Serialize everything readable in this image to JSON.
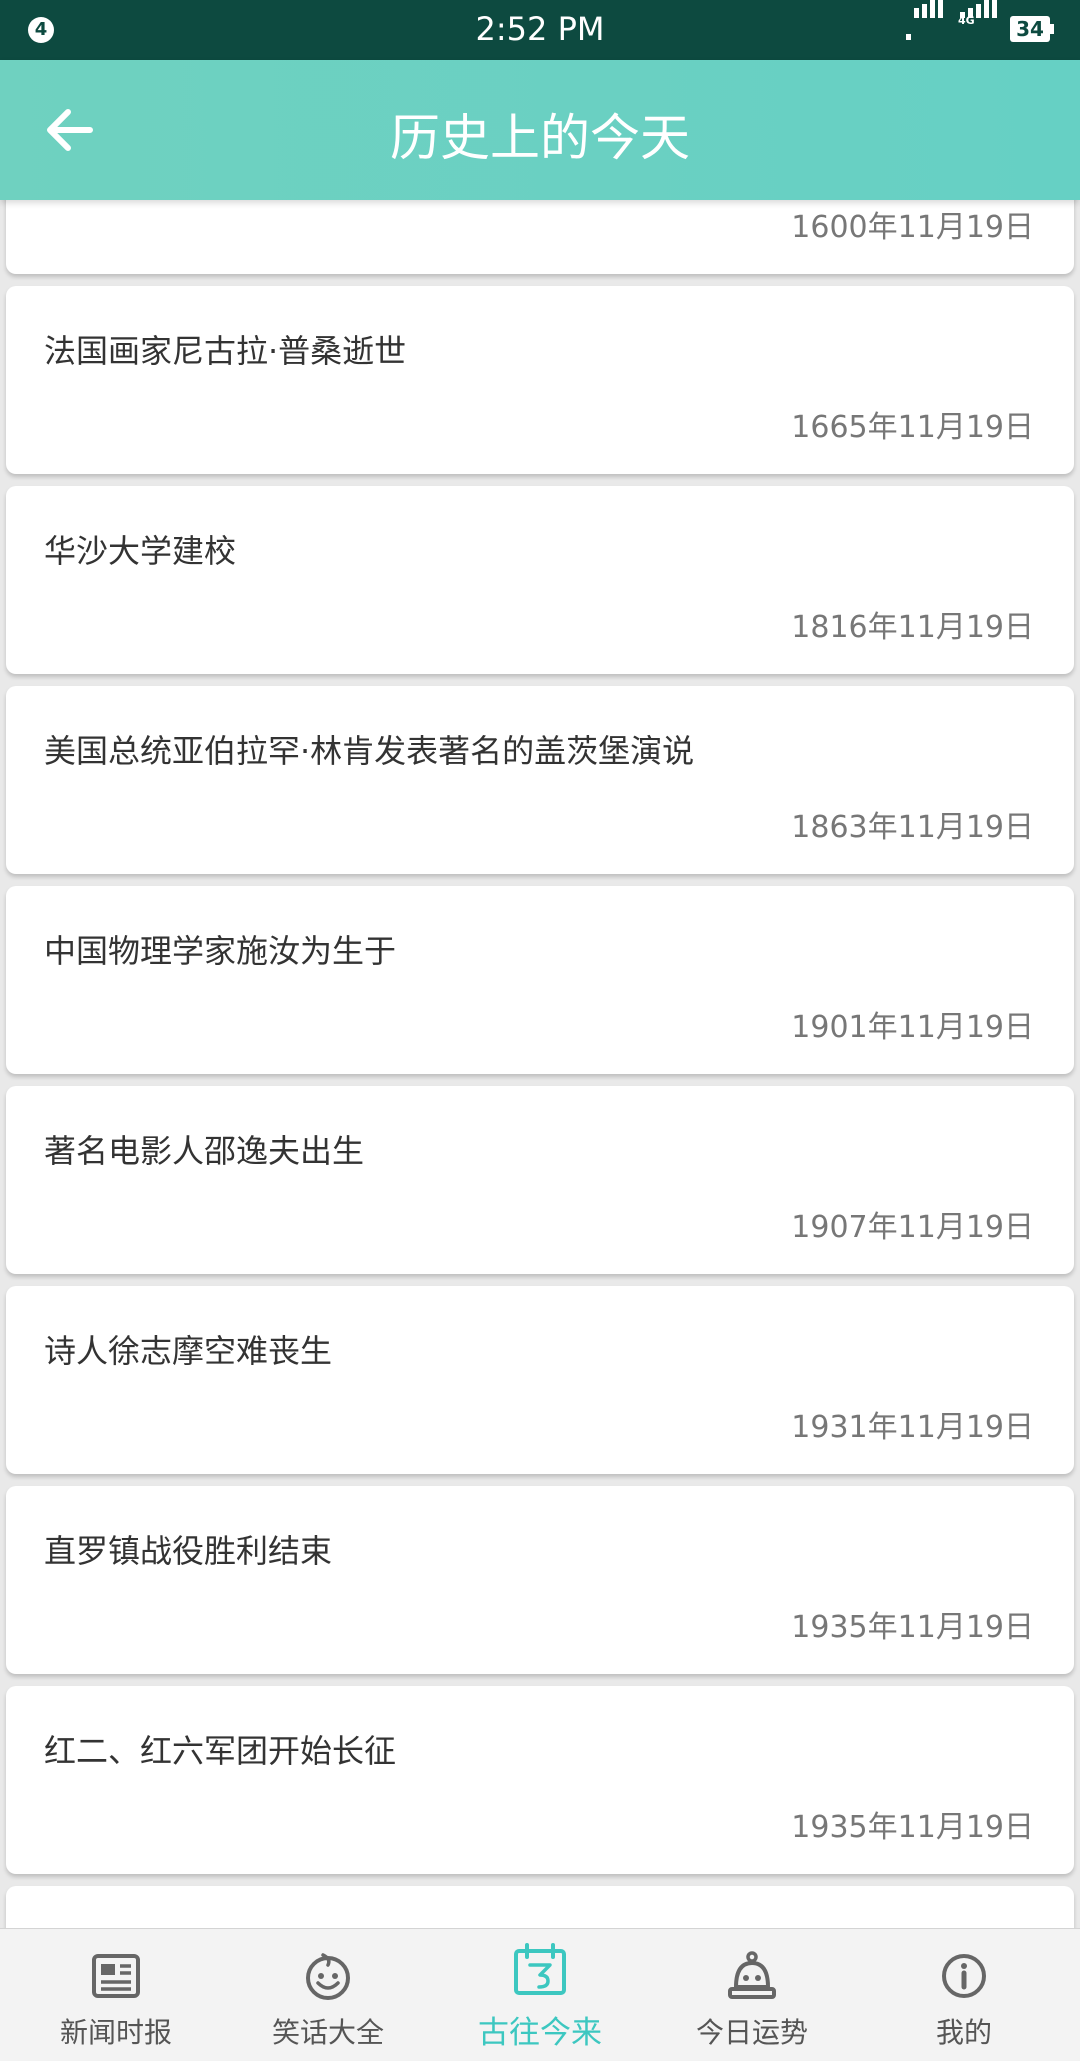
{
  "status_bar": {
    "notification_count": "4",
    "time": "2:52 PM",
    "network": "4G",
    "battery": "34"
  },
  "header": {
    "title": "历史上的今天",
    "back_icon": "arrow-left-icon"
  },
  "events": [
    {
      "title": "",
      "date": "1600年11月19日"
    },
    {
      "title": "法国画家尼古拉·普桑逝世",
      "date": "1665年11月19日"
    },
    {
      "title": "华沙大学建校",
      "date": "1816年11月19日"
    },
    {
      "title": "美国总统亚伯拉罕·林肯发表著名的盖茨堡演说",
      "date": "1863年11月19日"
    },
    {
      "title": "中国物理学家施汝为生于",
      "date": "1901年11月19日"
    },
    {
      "title": "著名电影人邵逸夫出生",
      "date": "1907年11月19日"
    },
    {
      "title": "诗人徐志摩空难丧生",
      "date": "1931年11月19日"
    },
    {
      "title": "直罗镇战役胜利结束",
      "date": "1935年11月19日"
    },
    {
      "title": "红二、红六军团开始长征",
      "date": "1935年11月19日"
    },
    {
      "title": "",
      "date": ""
    }
  ],
  "tabs": [
    {
      "label": "新闻时报",
      "icon": "newspaper-icon",
      "active": false
    },
    {
      "label": "笑话大全",
      "icon": "smiley-icon",
      "active": false
    },
    {
      "label": "古往今来",
      "icon": "calendar-icon",
      "active": true
    },
    {
      "label": "今日运势",
      "icon": "fortune-bell-icon",
      "active": false
    },
    {
      "label": "我的",
      "icon": "info-icon",
      "active": false
    }
  ],
  "colors": {
    "status_bar": "#0d4a40",
    "app_bar": "#6fd1c0",
    "active_tab": "#3cc7c0",
    "inactive_tab": "#555555"
  }
}
